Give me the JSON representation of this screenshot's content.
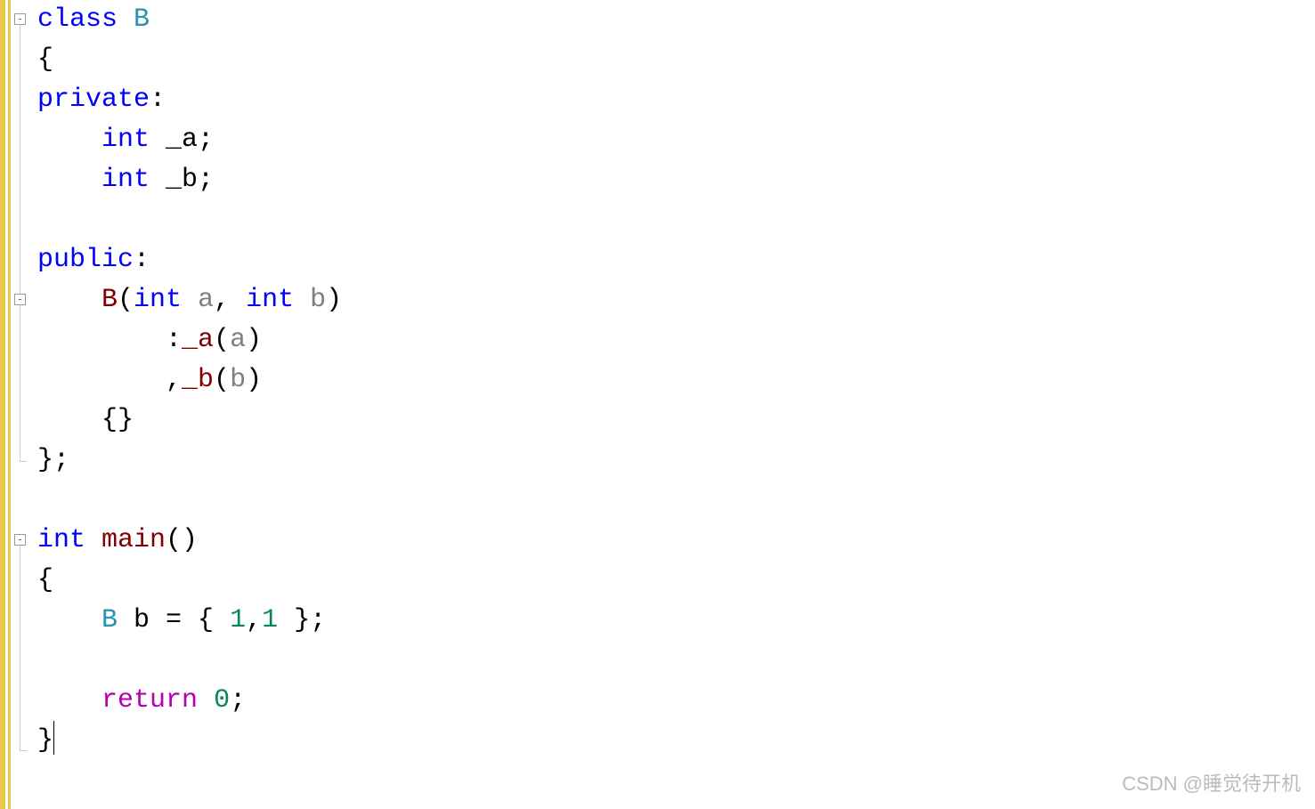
{
  "code": {
    "l1_class": "class",
    "l1_name": " B",
    "l2": "{",
    "l3_kw": "private",
    "l3_pn": ":",
    "l4_pre": "    ",
    "l4_int": "int",
    "l4_rest": " _a;",
    "l5_pre": "    ",
    "l5_int": "int",
    "l5_rest": " _b;",
    "l6": "",
    "l7_kw": "public",
    "l7_pn": ":",
    "l8_pre": "    ",
    "l8_B": "B",
    "l8_lp": "(",
    "l8_int1": "int",
    "l8_sp1": " ",
    "l8_a": "a",
    "l8_comma": ", ",
    "l8_int2": "int",
    "l8_sp2": " ",
    "l8_b": "b",
    "l8_rp": ")",
    "l9_pre": "        :",
    "l9_fn": "_a",
    "l9_lp": "(",
    "l9_a": "a",
    "l9_rp": ")",
    "l10_pre": "        ,",
    "l10_fn": "_b",
    "l10_lp": "(",
    "l10_b": "b",
    "l10_rp": ")",
    "l11_pre": "    ",
    "l11_br": "{}",
    "l12": "};",
    "l13": "",
    "l14_int": "int",
    "l14_sp": " ",
    "l14_fn": "main",
    "l14_p": "()",
    "l15": "{",
    "l16_pre": "    ",
    "l16_B": "B",
    "l16_rest": " b = { ",
    "l16_n1": "1",
    "l16_c": ",",
    "l16_n2": "1",
    "l16_end": " };",
    "l17": "",
    "l18_pre": "    ",
    "l18_ret": "return",
    "l18_sp": " ",
    "l18_n": "0",
    "l18_sc": ";",
    "l19": "}"
  },
  "fold": {
    "minus": "⊟"
  },
  "watermark": "CSDN @睡觉待开机"
}
